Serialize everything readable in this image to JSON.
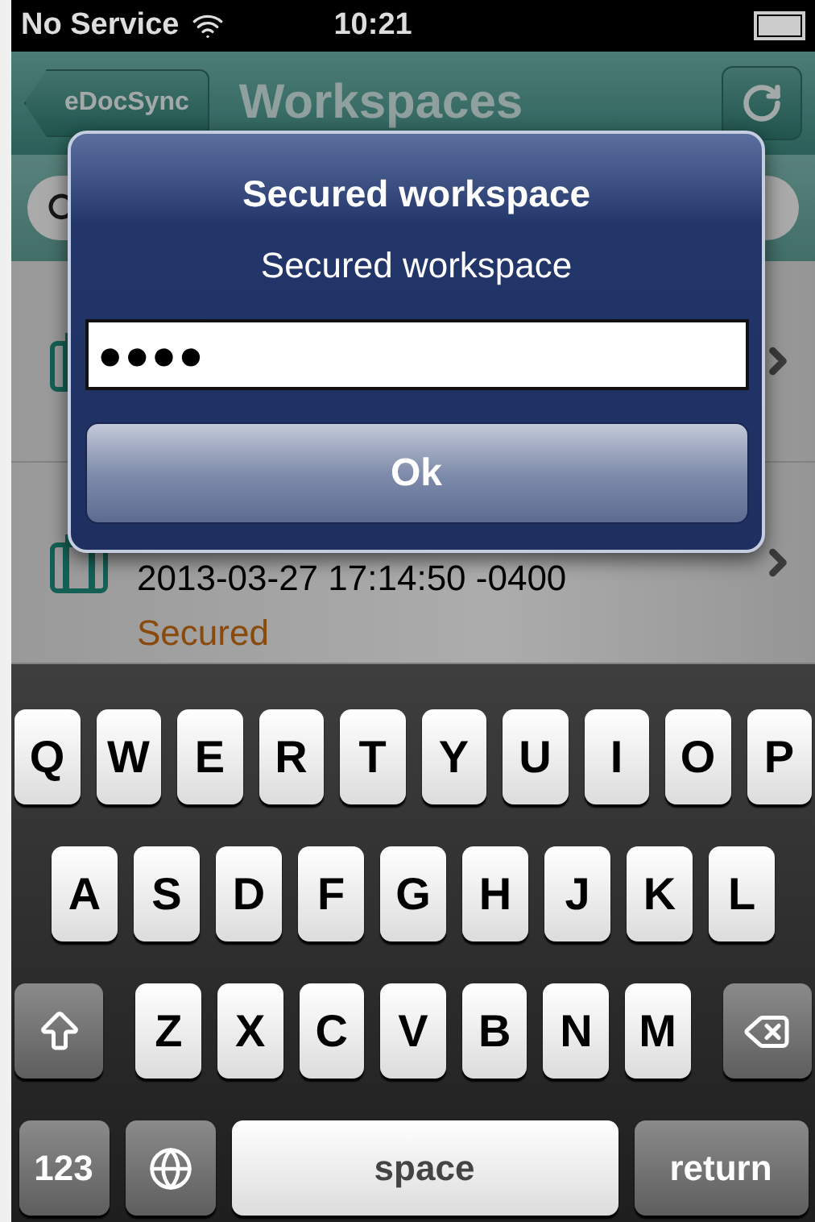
{
  "status_bar": {
    "carrier": "No Service",
    "time": "10:21"
  },
  "nav_bar": {
    "back": "eDocSync",
    "title": "Workspaces"
  },
  "rows": [
    {},
    {
      "date": "2013-03-27 17:14:50 -0400",
      "status": "Secured"
    }
  ],
  "alert": {
    "title": "Secured workspace",
    "message": "Secured workspace",
    "password": "●●●●",
    "button": "Ok"
  },
  "keyboard": {
    "rows": [
      [
        "Q",
        "W",
        "E",
        "R",
        "T",
        "Y",
        "U",
        "I",
        "O",
        "P"
      ],
      [
        "A",
        "S",
        "D",
        "F",
        "G",
        "H",
        "J",
        "K",
        "L"
      ],
      [
        "Z",
        "X",
        "C",
        "V",
        "B",
        "N",
        "M"
      ]
    ],
    "numbers": "123",
    "space": "space",
    "return": "return"
  }
}
